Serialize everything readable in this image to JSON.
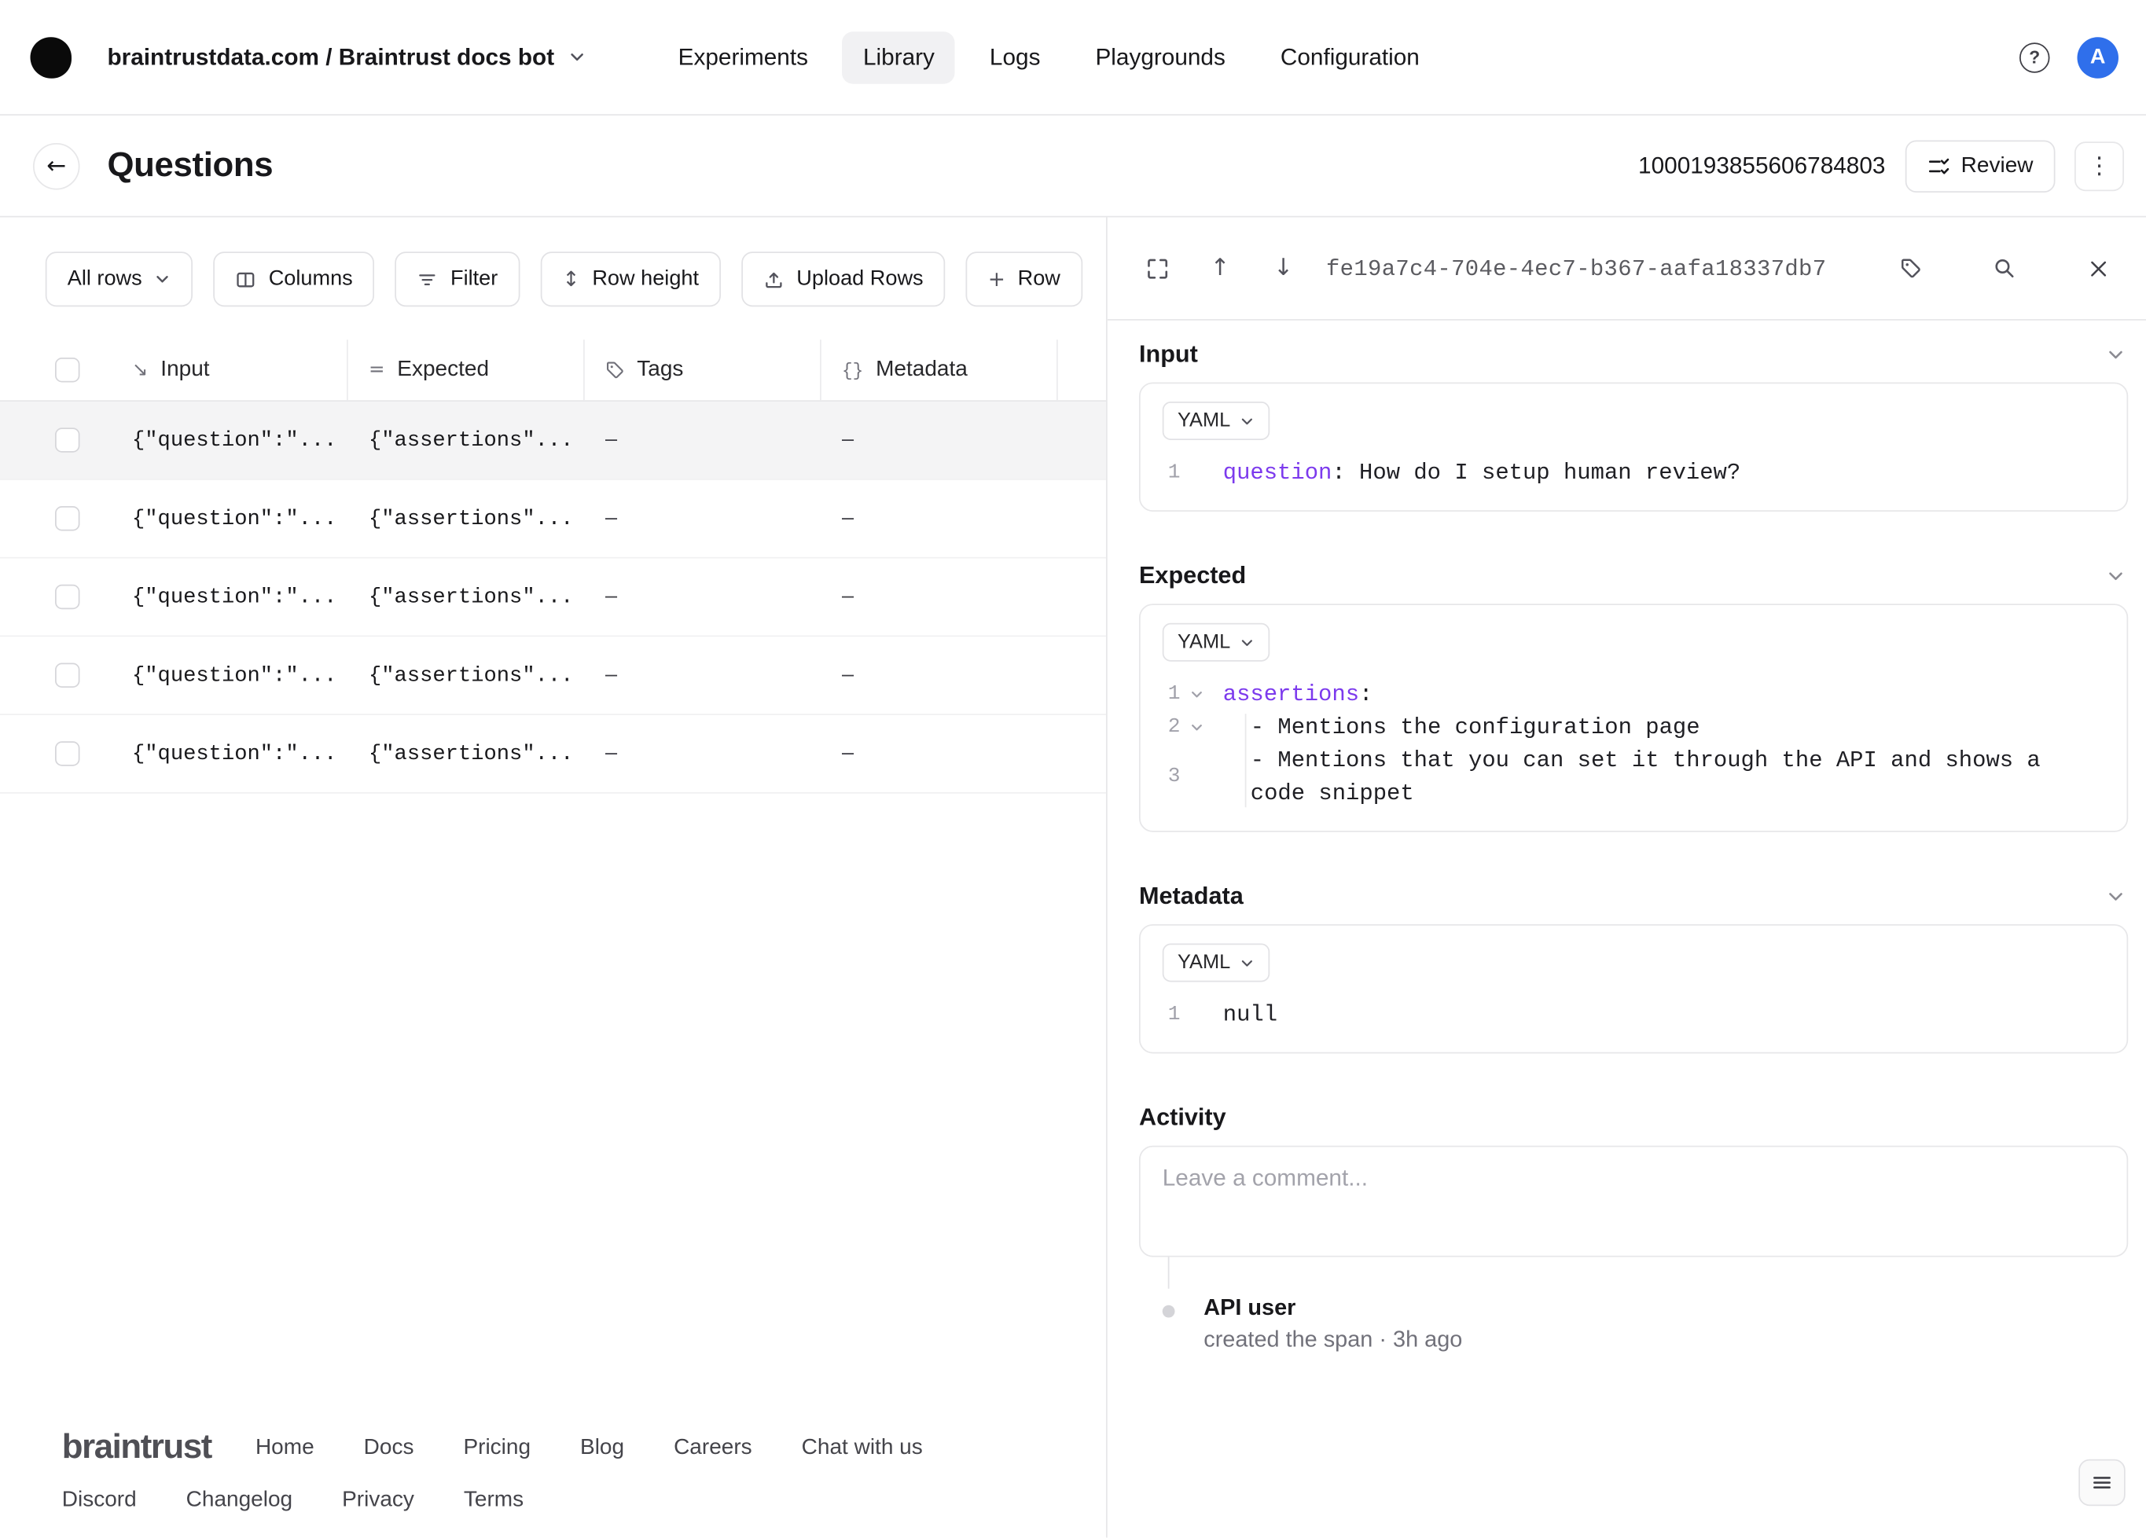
{
  "icons": {
    "back": "←",
    "kebab": "⋮",
    "row_height": "↕",
    "arrow_up": "↑",
    "arrow_down": "↓",
    "plus": "+",
    "equals": "=",
    "input_type": "↘",
    "braces": "{}",
    "help": "?"
  },
  "nav": {
    "breadcrumb": "braintrustdata.com / Braintrust docs bot",
    "items": [
      {
        "label": "Experiments"
      },
      {
        "label": "Library"
      },
      {
        "label": "Logs"
      },
      {
        "label": "Playgrounds"
      },
      {
        "label": "Configuration"
      }
    ],
    "avatar": "A"
  },
  "header": {
    "title": "Questions",
    "dataset_id": "1000193855606784803",
    "review": "Review"
  },
  "toolbar": {
    "all_rows": "All rows",
    "columns": "Columns",
    "filter": "Filter",
    "row_height": "Row height",
    "upload_rows": "Upload Rows",
    "row": "Row"
  },
  "table": {
    "headers": {
      "input": "Input",
      "expected": "Expected",
      "tags": "Tags",
      "metadata": "Metadata"
    },
    "rows": [
      {
        "input": "{\"question\":\"...",
        "expected": "{\"assertions\"...",
        "tags": "–",
        "metadata": "–"
      },
      {
        "input": "{\"question\":\"...",
        "expected": "{\"assertions\"...",
        "tags": "–",
        "metadata": "–"
      },
      {
        "input": "{\"question\":\"...",
        "expected": "{\"assertions\"...",
        "tags": "–",
        "metadata": "–"
      },
      {
        "input": "{\"question\":\"...",
        "expected": "{\"assertions\"...",
        "tags": "–",
        "metadata": "–"
      },
      {
        "input": "{\"question\":\"...",
        "expected": "{\"assertions\"...",
        "tags": "–",
        "metadata": "–"
      }
    ]
  },
  "footer": {
    "brand": "braintrust",
    "links1": [
      "Home",
      "Docs",
      "Pricing",
      "Blog",
      "Careers",
      "Chat with us"
    ],
    "links2": [
      "Discord",
      "Changelog",
      "Privacy",
      "Terms"
    ]
  },
  "detail": {
    "span_id": "fe19a7c4-704e-4ec7-b367-aafa18337db7",
    "yaml": "YAML",
    "input": {
      "title": "Input",
      "lines": [
        {
          "num": "1",
          "key": "question",
          "rest": ": How do I setup human review?"
        }
      ]
    },
    "expected": {
      "title": "Expected",
      "lines": [
        {
          "num": "1",
          "key": "assertions",
          "rest": ":"
        },
        {
          "num": "2",
          "text": "- Mentions the configuration page"
        },
        {
          "num": "3",
          "text": "- Mentions that you can set it through the API and shows a\ncode snippet"
        }
      ]
    },
    "metadata": {
      "title": "Metadata",
      "lines": [
        {
          "num": "1",
          "text": "null"
        }
      ]
    },
    "activity": {
      "title": "Activity",
      "placeholder": "Leave a comment...",
      "event_user": "API user",
      "event_text": "created the span · 3h ago"
    }
  }
}
